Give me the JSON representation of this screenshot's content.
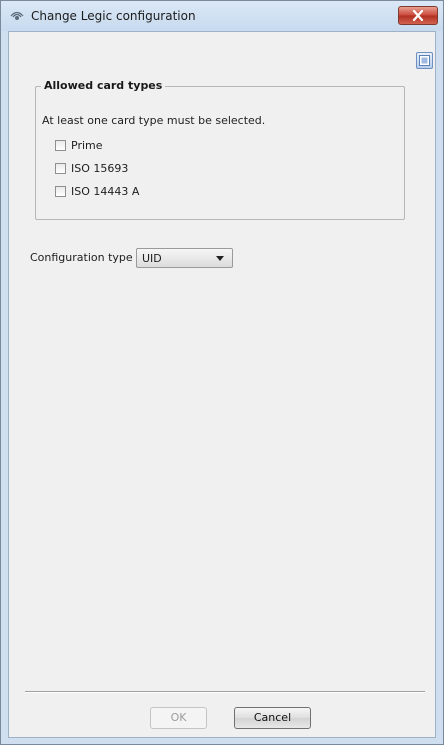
{
  "window": {
    "title": "Change Legic configuration",
    "icons": {
      "app": "wifi-eye-icon",
      "close": "close-icon",
      "help": "help-icon"
    }
  },
  "group": {
    "legend": "Allowed card types",
    "hint": "At least one card type must be selected.",
    "checkboxes": [
      {
        "label": "Prime",
        "checked": false
      },
      {
        "label": "ISO 15693",
        "checked": false
      },
      {
        "label": "ISO 14443 A",
        "checked": false
      }
    ]
  },
  "config": {
    "label": "Configuration type",
    "selected": "UID"
  },
  "buttons": {
    "ok": "OK",
    "cancel": "Cancel"
  },
  "colors": {
    "titlebar": "#c7daee",
    "client_bg": "#f0f0f0",
    "close_red": "#c9463a"
  }
}
